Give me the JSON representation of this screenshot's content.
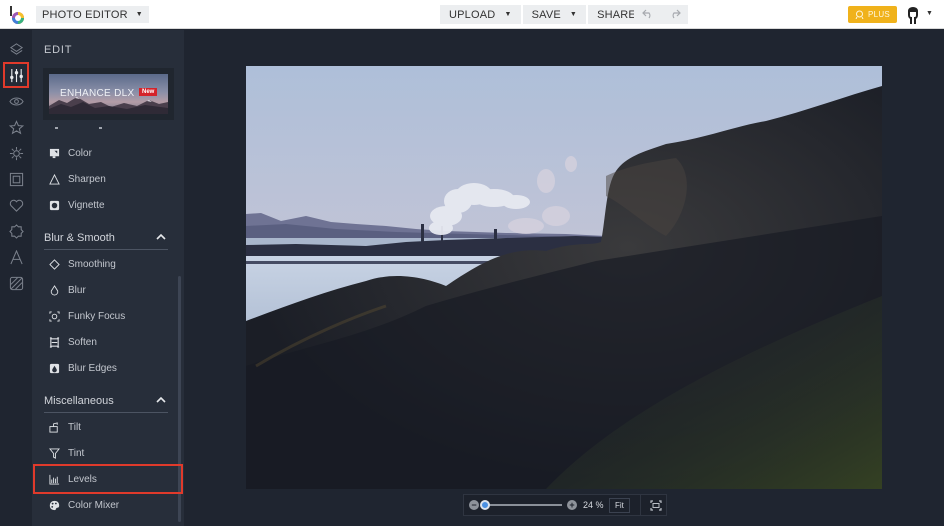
{
  "header": {
    "app_menu_label": "PHOTO EDITOR",
    "buttons": [
      {
        "label": "UPLOAD"
      },
      {
        "label": "SAVE"
      },
      {
        "label": "SHARE"
      }
    ],
    "undo_icon": "undo-icon",
    "redo_icon": "redo-icon",
    "plus_label": "PLUS"
  },
  "rail": {
    "items": [
      {
        "name": "layers",
        "icon": "layers-icon"
      },
      {
        "name": "edit",
        "icon": "sliders-icon",
        "active": true
      },
      {
        "name": "touch-up",
        "icon": "eye-icon"
      },
      {
        "name": "effects",
        "icon": "star-icon"
      },
      {
        "name": "overlays",
        "icon": "gear-flower-icon"
      },
      {
        "name": "frames",
        "icon": "frame-icon"
      },
      {
        "name": "graphics",
        "icon": "heart-icon"
      },
      {
        "name": "textures",
        "icon": "badge-icon"
      },
      {
        "name": "text",
        "icon": "text-icon"
      },
      {
        "name": "textures-pattern",
        "icon": "hatch-icon"
      }
    ]
  },
  "panel": {
    "title": "EDIT",
    "banner": {
      "text": "ENHANCE DLX",
      "badge": "New"
    },
    "items_top": [
      {
        "label": "Color",
        "icon": "color-icon"
      },
      {
        "label": "Sharpen",
        "icon": "triangle-icon"
      },
      {
        "label": "Vignette",
        "icon": "vignette-icon"
      }
    ],
    "sections": [
      {
        "title": "Blur & Smooth",
        "expanded": true,
        "items": [
          {
            "label": "Smoothing",
            "icon": "diamond-icon"
          },
          {
            "label": "Blur",
            "icon": "drop-icon"
          },
          {
            "label": "Funky Focus",
            "icon": "focus-icon"
          },
          {
            "label": "Soften",
            "icon": "soften-icon"
          },
          {
            "label": "Blur Edges",
            "icon": "blur-edges-icon"
          }
        ]
      },
      {
        "title": "Miscellaneous",
        "expanded": true,
        "items": [
          {
            "label": "Tilt",
            "icon": "tilt-icon"
          },
          {
            "label": "Tint",
            "icon": "funnel-icon"
          },
          {
            "label": "Levels",
            "icon": "histogram-icon",
            "highlighted": true
          },
          {
            "label": "Color Mixer",
            "icon": "palette-icon"
          }
        ]
      }
    ]
  },
  "zoom": {
    "value_label": "24 %",
    "value_percent": 24,
    "fit_label": "Fit"
  },
  "colors": {
    "highlight": "#e03a2b",
    "plus": "#f0b21b",
    "slider": "#4a90e2"
  }
}
